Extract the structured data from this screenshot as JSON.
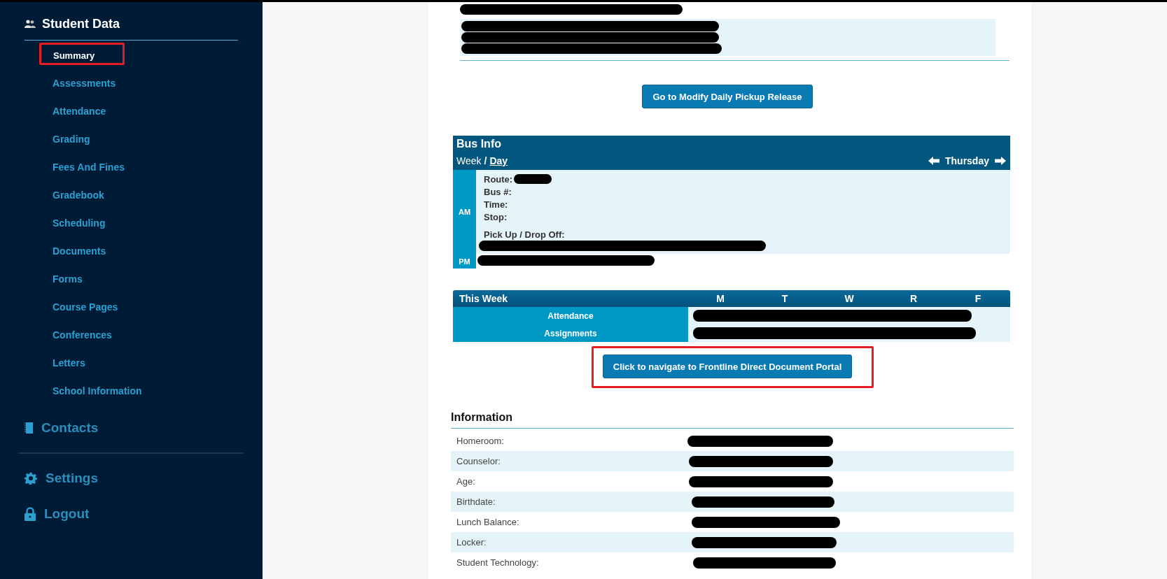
{
  "sidebar": {
    "section": {
      "title": "Student Data",
      "items": [
        {
          "label": "Summary",
          "selected": true,
          "annotated": true
        },
        {
          "label": "Assessments",
          "selected": false,
          "annotated": false
        },
        {
          "label": "Attendance",
          "selected": false,
          "annotated": false
        },
        {
          "label": "Grading",
          "selected": false,
          "annotated": false
        },
        {
          "label": "Fees And Fines",
          "selected": false,
          "annotated": false
        },
        {
          "label": "Gradebook",
          "selected": false,
          "annotated": false
        },
        {
          "label": "Scheduling",
          "selected": false,
          "annotated": false
        },
        {
          "label": "Documents",
          "selected": false,
          "annotated": false
        },
        {
          "label": "Forms",
          "selected": false,
          "annotated": false
        },
        {
          "label": "Course Pages",
          "selected": false,
          "annotated": false
        },
        {
          "label": "Conferences",
          "selected": false,
          "annotated": false
        },
        {
          "label": "Letters",
          "selected": false,
          "annotated": false
        },
        {
          "label": "School Information",
          "selected": false,
          "annotated": false
        }
      ]
    },
    "links": [
      {
        "label": "Contacts",
        "kind": "contacts"
      },
      {
        "label": "Settings",
        "kind": "settings"
      },
      {
        "label": "Logout",
        "kind": "logout"
      }
    ]
  },
  "pickup_button": {
    "label": "Go to Modify Daily Pickup Release"
  },
  "bus_info": {
    "title": "Bus Info",
    "views": [
      {
        "label": "Week",
        "selected": false
      },
      {
        "label": "Day",
        "selected": true
      }
    ],
    "separator": "/",
    "day": "Thursday",
    "am": {
      "label": "AM",
      "fields": [
        "Route:",
        "Bus #:",
        "Time:",
        "Stop:"
      ],
      "pickup_label": "Pick Up / Drop Off:"
    },
    "pm": {
      "label": "PM"
    }
  },
  "this_week": {
    "title": "This Week",
    "days": [
      "M",
      "T",
      "W",
      "R",
      "F"
    ],
    "rows": [
      "Attendance",
      "Assignments"
    ]
  },
  "portal_button": {
    "label": "Click to navigate to Frontline Direct Document Portal",
    "annotated": true
  },
  "information": {
    "title": "Information",
    "rows": [
      "Homeroom:",
      "Counselor:",
      "Age:",
      "Birthdate:",
      "Lunch Balance:",
      "Locker:",
      "Student Technology:"
    ]
  }
}
